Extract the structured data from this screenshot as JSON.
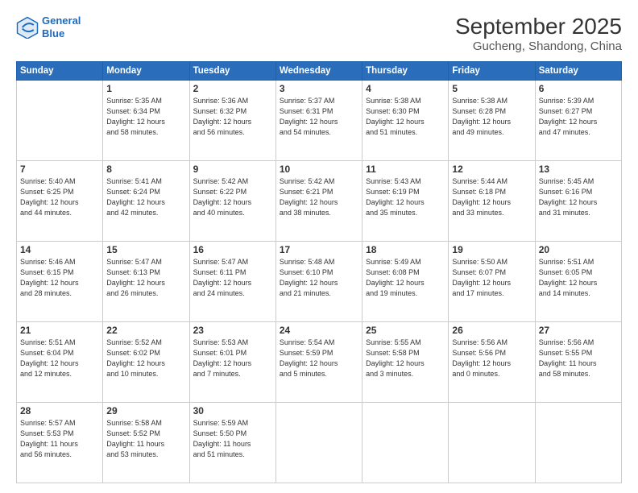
{
  "header": {
    "logo_line1": "General",
    "logo_line2": "Blue",
    "title": "September 2025",
    "subtitle": "Gucheng, Shandong, China"
  },
  "days_of_week": [
    "Sunday",
    "Monday",
    "Tuesday",
    "Wednesday",
    "Thursday",
    "Friday",
    "Saturday"
  ],
  "weeks": [
    [
      {
        "day": "",
        "info": ""
      },
      {
        "day": "1",
        "info": "Sunrise: 5:35 AM\nSunset: 6:34 PM\nDaylight: 12 hours\nand 58 minutes."
      },
      {
        "day": "2",
        "info": "Sunrise: 5:36 AM\nSunset: 6:32 PM\nDaylight: 12 hours\nand 56 minutes."
      },
      {
        "day": "3",
        "info": "Sunrise: 5:37 AM\nSunset: 6:31 PM\nDaylight: 12 hours\nand 54 minutes."
      },
      {
        "day": "4",
        "info": "Sunrise: 5:38 AM\nSunset: 6:30 PM\nDaylight: 12 hours\nand 51 minutes."
      },
      {
        "day": "5",
        "info": "Sunrise: 5:38 AM\nSunset: 6:28 PM\nDaylight: 12 hours\nand 49 minutes."
      },
      {
        "day": "6",
        "info": "Sunrise: 5:39 AM\nSunset: 6:27 PM\nDaylight: 12 hours\nand 47 minutes."
      }
    ],
    [
      {
        "day": "7",
        "info": "Sunrise: 5:40 AM\nSunset: 6:25 PM\nDaylight: 12 hours\nand 44 minutes."
      },
      {
        "day": "8",
        "info": "Sunrise: 5:41 AM\nSunset: 6:24 PM\nDaylight: 12 hours\nand 42 minutes."
      },
      {
        "day": "9",
        "info": "Sunrise: 5:42 AM\nSunset: 6:22 PM\nDaylight: 12 hours\nand 40 minutes."
      },
      {
        "day": "10",
        "info": "Sunrise: 5:42 AM\nSunset: 6:21 PM\nDaylight: 12 hours\nand 38 minutes."
      },
      {
        "day": "11",
        "info": "Sunrise: 5:43 AM\nSunset: 6:19 PM\nDaylight: 12 hours\nand 35 minutes."
      },
      {
        "day": "12",
        "info": "Sunrise: 5:44 AM\nSunset: 6:18 PM\nDaylight: 12 hours\nand 33 minutes."
      },
      {
        "day": "13",
        "info": "Sunrise: 5:45 AM\nSunset: 6:16 PM\nDaylight: 12 hours\nand 31 minutes."
      }
    ],
    [
      {
        "day": "14",
        "info": "Sunrise: 5:46 AM\nSunset: 6:15 PM\nDaylight: 12 hours\nand 28 minutes."
      },
      {
        "day": "15",
        "info": "Sunrise: 5:47 AM\nSunset: 6:13 PM\nDaylight: 12 hours\nand 26 minutes."
      },
      {
        "day": "16",
        "info": "Sunrise: 5:47 AM\nSunset: 6:11 PM\nDaylight: 12 hours\nand 24 minutes."
      },
      {
        "day": "17",
        "info": "Sunrise: 5:48 AM\nSunset: 6:10 PM\nDaylight: 12 hours\nand 21 minutes."
      },
      {
        "day": "18",
        "info": "Sunrise: 5:49 AM\nSunset: 6:08 PM\nDaylight: 12 hours\nand 19 minutes."
      },
      {
        "day": "19",
        "info": "Sunrise: 5:50 AM\nSunset: 6:07 PM\nDaylight: 12 hours\nand 17 minutes."
      },
      {
        "day": "20",
        "info": "Sunrise: 5:51 AM\nSunset: 6:05 PM\nDaylight: 12 hours\nand 14 minutes."
      }
    ],
    [
      {
        "day": "21",
        "info": "Sunrise: 5:51 AM\nSunset: 6:04 PM\nDaylight: 12 hours\nand 12 minutes."
      },
      {
        "day": "22",
        "info": "Sunrise: 5:52 AM\nSunset: 6:02 PM\nDaylight: 12 hours\nand 10 minutes."
      },
      {
        "day": "23",
        "info": "Sunrise: 5:53 AM\nSunset: 6:01 PM\nDaylight: 12 hours\nand 7 minutes."
      },
      {
        "day": "24",
        "info": "Sunrise: 5:54 AM\nSunset: 5:59 PM\nDaylight: 12 hours\nand 5 minutes."
      },
      {
        "day": "25",
        "info": "Sunrise: 5:55 AM\nSunset: 5:58 PM\nDaylight: 12 hours\nand 3 minutes."
      },
      {
        "day": "26",
        "info": "Sunrise: 5:56 AM\nSunset: 5:56 PM\nDaylight: 12 hours\nand 0 minutes."
      },
      {
        "day": "27",
        "info": "Sunrise: 5:56 AM\nSunset: 5:55 PM\nDaylight: 11 hours\nand 58 minutes."
      }
    ],
    [
      {
        "day": "28",
        "info": "Sunrise: 5:57 AM\nSunset: 5:53 PM\nDaylight: 11 hours\nand 56 minutes."
      },
      {
        "day": "29",
        "info": "Sunrise: 5:58 AM\nSunset: 5:52 PM\nDaylight: 11 hours\nand 53 minutes."
      },
      {
        "day": "30",
        "info": "Sunrise: 5:59 AM\nSunset: 5:50 PM\nDaylight: 11 hours\nand 51 minutes."
      },
      {
        "day": "",
        "info": ""
      },
      {
        "day": "",
        "info": ""
      },
      {
        "day": "",
        "info": ""
      },
      {
        "day": "",
        "info": ""
      }
    ]
  ]
}
